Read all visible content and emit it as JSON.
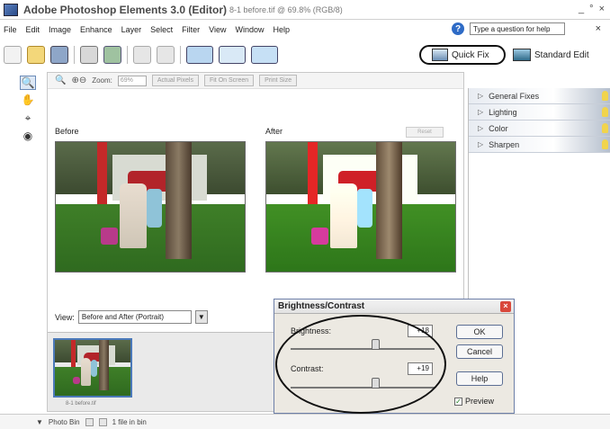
{
  "window": {
    "title": "Adobe Photoshop Elements 3.0 (Editor)",
    "subtitle": "8-1 before.tif @ 69.8% (RGB/8)",
    "controls": [
      "_",
      "°",
      "×"
    ]
  },
  "menu": [
    "File",
    "Edit",
    "Image",
    "Enhance",
    "Layer",
    "Select",
    "Filter",
    "View",
    "Window",
    "Help"
  ],
  "help": {
    "icon": "help-icon",
    "placeholder": "Type a question for help",
    "close": "×"
  },
  "modes": {
    "quick_fix": "Quick Fix",
    "standard_edit": "Standard Edit"
  },
  "options_bar": {
    "zoom_label": "Zoom:",
    "zoom_value": "69%",
    "actual_pixels": "Actual Pixels",
    "fit_on_screen": "Fit On Screen",
    "print_size": "Print Size"
  },
  "panes": {
    "before": "Before",
    "after": "After",
    "reset": "Reset"
  },
  "view": {
    "label": "View:",
    "value": "Before and After (Portrait)"
  },
  "bin": {
    "filename": "8-1 before.tif"
  },
  "palette": [
    {
      "label": "General Fixes"
    },
    {
      "label": "Lighting"
    },
    {
      "label": "Color"
    },
    {
      "label": "Sharpen"
    }
  ],
  "status": {
    "photo_bin": "Photo Bin",
    "file_count": "1 file in bin"
  },
  "dialog": {
    "title": "Brightness/Contrast",
    "brightness_label": "Brightness:",
    "brightness_value": "+18",
    "contrast_label": "Contrast:",
    "contrast_value": "+19",
    "ok": "OK",
    "cancel": "Cancel",
    "help": "Help",
    "preview": "Preview",
    "preview_checked": true
  }
}
